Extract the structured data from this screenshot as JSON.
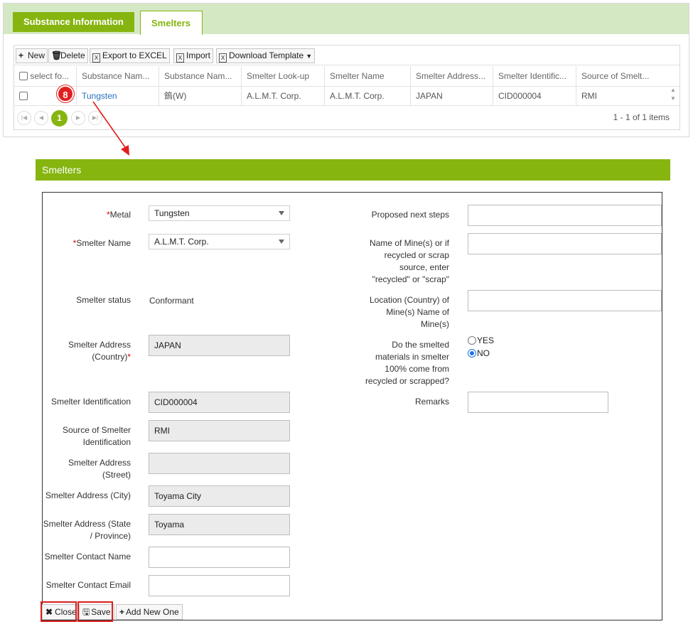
{
  "tabs": [
    {
      "label": "Substance Information",
      "active": true
    },
    {
      "label": "Smelters",
      "active": false
    }
  ],
  "toolbar": {
    "new_label": "New",
    "delete_label": "Delete",
    "export_label": "Export to EXCEL",
    "import_label": "Import",
    "download_label": "Download Template"
  },
  "grid": {
    "columns": [
      "select fo...",
      "Substance Nam...",
      "Substance Nam...",
      "Smelter Look-up",
      "Smelter Name",
      "Smelter Address...",
      "Smelter Identific...",
      "Source of Smelt..."
    ],
    "rows": [
      {
        "substance": "Tungsten",
        "substance_local": "鎢(W)",
        "lookup": "A.L.M.T. Corp.",
        "name": "A.L.M.T. Corp.",
        "address": "JAPAN",
        "identification": "CID000004",
        "source": "RMI"
      }
    ],
    "pager": {
      "page": "1",
      "info": "1 - 1 of 1 items"
    }
  },
  "callout_number": "8",
  "form": {
    "title": "Smelters",
    "metal_label": "Metal",
    "metal_value": "Tungsten",
    "smelter_name_label": "Smelter Name",
    "smelter_name_value": "A.L.M.T. Corp.",
    "status_label": "Smelter status",
    "status_value": "Conformant",
    "address_country_label_1": "Smelter Address",
    "address_country_label_2": "(Country)",
    "address_country_value": "JAPAN",
    "identification_label": "Smelter Identification",
    "identification_value": "CID000004",
    "source_label_1": "Source of Smelter",
    "source_label_2": "Identification",
    "source_value": "RMI",
    "street_label_1": "Smelter Address",
    "street_label_2": "(Street)",
    "street_value": "",
    "city_label": "Smelter Address (City)",
    "city_value": "Toyama City",
    "state_label_1": "Smelter Address (State",
    "state_label_2": "/ Province)",
    "state_value": "Toyama",
    "contact_name_label": "Smelter Contact Name",
    "contact_name_value": "",
    "contact_email_label": "Smelter Contact Email",
    "contact_email_value": "",
    "next_steps_label": "Proposed next steps",
    "mine_name_label": [
      "Name of Mine(s) or if",
      "recycled or scrap",
      "source, enter",
      "\"recycled\" or \"scrap\""
    ],
    "mine_location_label": [
      "Location (Country) of",
      "Mine(s) Name of",
      "Mine(s)"
    ],
    "recycled_label": [
      "Do the smelted",
      "materials in smelter",
      "100% come from",
      "recycled or scrapped?"
    ],
    "recycled_options": [
      "YES",
      "NO"
    ],
    "recycled_selected": "NO",
    "remarks_label": "Remarks",
    "close_label": "Close",
    "save_label": "Save",
    "add_new_label": "Add New One"
  },
  "colors": {
    "accent": "#86b50f",
    "highlight": "#d81e1e"
  }
}
